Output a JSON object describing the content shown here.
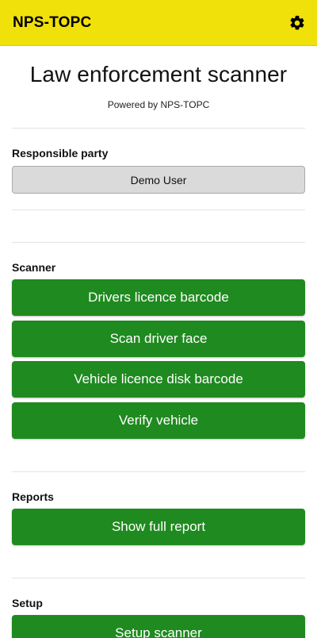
{
  "appbar": {
    "title": "NPS-TOPC",
    "settings_icon": "gear-icon"
  },
  "header": {
    "title": "Law enforcement scanner",
    "powered_by": "Powered by NPS-TOPC"
  },
  "responsible_party": {
    "label": "Responsible party",
    "value": "Demo User"
  },
  "scanner": {
    "label": "Scanner",
    "buttons": [
      "Drivers licence barcode",
      "Scan driver face",
      "Vehicle licence disk barcode",
      "Verify vehicle"
    ]
  },
  "reports": {
    "label": "Reports",
    "button": "Show full report"
  },
  "setup": {
    "label": "Setup",
    "button": "Setup scanner"
  },
  "colors": {
    "appbar": "#f1e10a",
    "primary_button": "#1f8a1f",
    "secondary_button": "#dadada"
  }
}
